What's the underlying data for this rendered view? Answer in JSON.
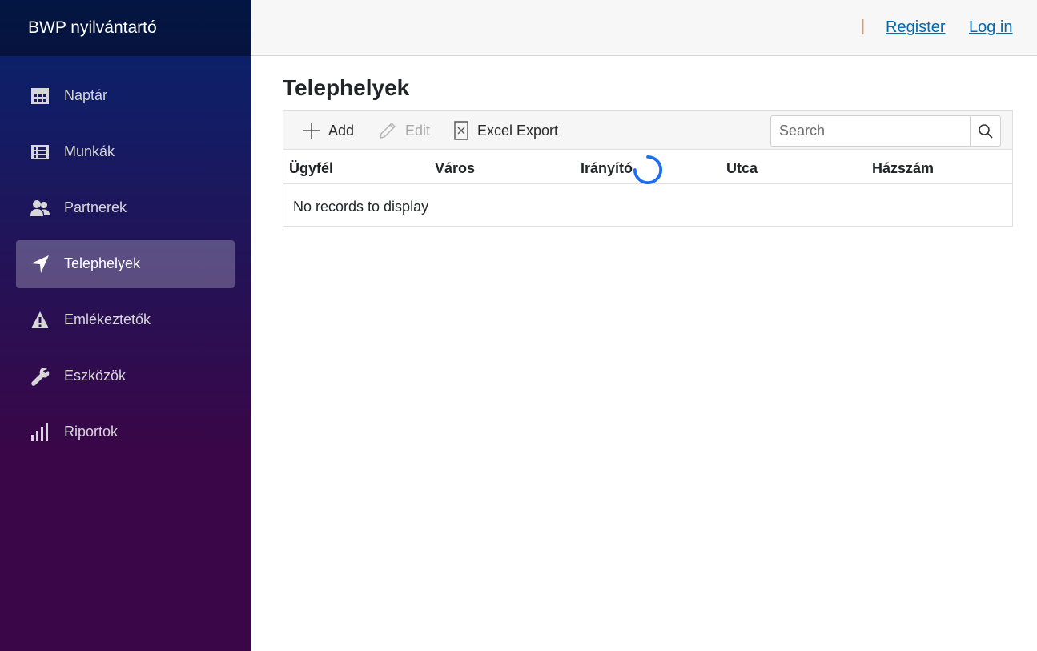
{
  "app": {
    "brand": "BWP nyilvántartó"
  },
  "sidebar": {
    "items": [
      {
        "label": "Naptár",
        "icon": "calendar-icon"
      },
      {
        "label": "Munkák",
        "icon": "list-icon"
      },
      {
        "label": "Partnerek",
        "icon": "people-icon"
      },
      {
        "label": "Telephelyek",
        "icon": "location-arrow-icon",
        "active": true
      },
      {
        "label": "Emlékeztetők",
        "icon": "warning-icon"
      },
      {
        "label": "Eszközök",
        "icon": "wrench-icon"
      },
      {
        "label": "Riportok",
        "icon": "bar-chart-icon"
      }
    ]
  },
  "topbar": {
    "separator": "|",
    "register": "Register",
    "login": "Log in"
  },
  "page": {
    "title": "Telephelyek"
  },
  "grid": {
    "toolbar": {
      "add": "Add",
      "edit": "Edit",
      "excel": "Excel Export"
    },
    "search": {
      "placeholder": "Search"
    },
    "columns": [
      "Ügyfél",
      "Város",
      "Irányító",
      "Utca",
      "Házszám"
    ],
    "empty_message": "No records to display"
  },
  "colors": {
    "sidebar_top": "#05246e",
    "sidebar_bottom": "#3a0647",
    "link": "#006bb7",
    "spinner": "#1b6ef3"
  }
}
